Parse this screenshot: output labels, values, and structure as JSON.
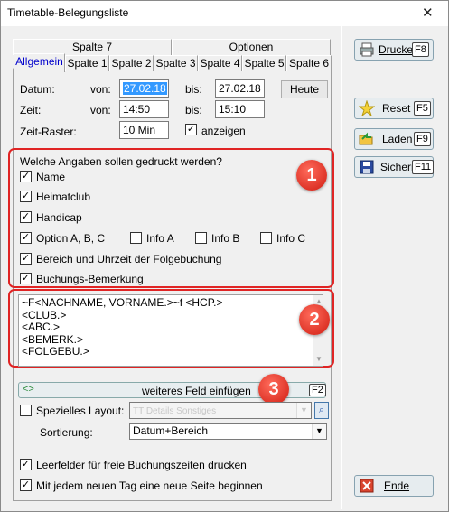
{
  "window": {
    "title": "Timetable-Belegungsliste",
    "close_glyph": "✕"
  },
  "tabs": {
    "row_top": [
      "Spalte 7",
      "Optionen"
    ],
    "row_bottom": [
      "Allgemein",
      "Spalte 1",
      "Spalte 2",
      "Spalte 3",
      "Spalte 4",
      "Spalte 5",
      "Spalte 6"
    ]
  },
  "date": {
    "label": "Datum:",
    "from_label": "von:",
    "from_value": "27.02.18",
    "to_label": "bis:",
    "to_value": "27.02.18",
    "today_button": "Heute"
  },
  "time": {
    "label": "Zeit:",
    "from_label": "von:",
    "from_value": "14:50",
    "to_label": "bis:",
    "to_value": "15:10"
  },
  "raster": {
    "label": "Zeit-Raster:",
    "value": "10 Min",
    "show_label": "anzeigen",
    "show_checked": true
  },
  "print_fields": {
    "question": "Welche Angaben sollen gedruckt werden?",
    "items": [
      {
        "label": "Name",
        "checked": true
      },
      {
        "label": "Heimatclub",
        "checked": true
      },
      {
        "label": "Handicap",
        "checked": true
      },
      {
        "label": "Option A, B, C",
        "checked": true
      },
      {
        "label": "Bereich und Uhrzeit der Folgebuchung",
        "checked": true
      },
      {
        "label": "Buchungs-Bemerkung",
        "checked": true
      }
    ],
    "info": [
      {
        "label": "Info A",
        "checked": false
      },
      {
        "label": "Info B",
        "checked": false
      },
      {
        "label": "Info C",
        "checked": false
      }
    ]
  },
  "template_lines": [
    "~F<NACHNAME, VORNAME.>~f <HCP.>",
    "<CLUB.>",
    "<ABC.>",
    "<BEMERK.>",
    "<FOLGEBU.>"
  ],
  "insert_field": {
    "label": "weiteres Feld einfügen",
    "key": "F2",
    "icon": "<>"
  },
  "layout": {
    "label": "Spezielles Layout:",
    "checked": false,
    "value": "TT Details Sonstiges"
  },
  "sort": {
    "label": "Sortierung:",
    "value": "Datum+Bereich"
  },
  "options": [
    {
      "label": "Leerfelder für freie Buchungszeiten drucken",
      "checked": true
    },
    {
      "label": "Mit jedem neuen Tag eine neue Seite beginnen",
      "checked": true
    }
  ],
  "buttons": {
    "print": {
      "label": "Drucken",
      "key": "F8"
    },
    "reset": {
      "label": "Reset",
      "key": "F5"
    },
    "load": {
      "label": "Laden",
      "key": "F9"
    },
    "save": {
      "label": "Sichern",
      "key": "F11"
    },
    "end": {
      "label": "Ende"
    }
  },
  "badges": [
    "1",
    "2",
    "3"
  ],
  "colors": {
    "annotation_red": "#e02424",
    "selection_blue": "#3399ff"
  }
}
